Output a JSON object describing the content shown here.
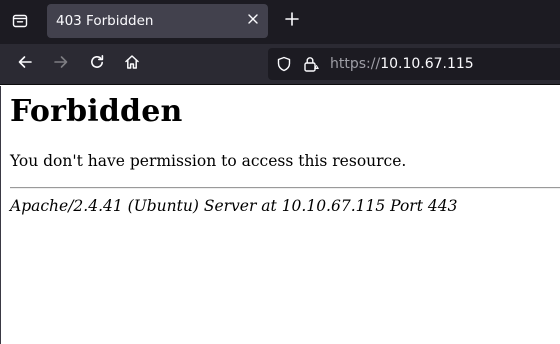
{
  "browser": {
    "tabs": [
      {
        "title": "403 Forbidden"
      }
    ],
    "address_bar": {
      "scheme": "https://",
      "host": "10.10.67.115"
    },
    "icons": {
      "tab_list": "tab-list-icon",
      "close": "close-icon",
      "new_tab": "plus-icon",
      "back": "arrow-left-icon",
      "forward": "arrow-right-icon",
      "reload": "reload-icon",
      "home": "home-icon",
      "tracking": "shield-icon",
      "security": "lock-icon"
    },
    "colors": {
      "tabbar_bg": "#1c1b22",
      "active_tab_bg": "#42414d",
      "toolbar_bg": "#2b2a33",
      "urlbar_bg": "#1c1b22",
      "icon": "#fbfbfe",
      "disabled_icon": "#7e7d83"
    }
  },
  "page": {
    "heading": "Forbidden",
    "message": "You don't have permission to access this resource.",
    "server_signature": "Apache/2.4.41 (Ubuntu) Server at 10.10.67.115 Port 443"
  }
}
